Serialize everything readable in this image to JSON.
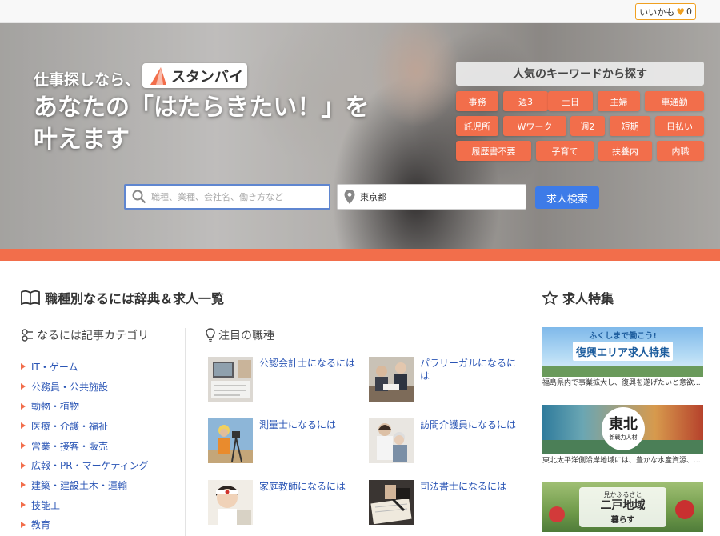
{
  "header": {
    "fav_label": "いいかも",
    "fav_count": "0"
  },
  "hero": {
    "lead": "仕事探しなら、",
    "brand_name": "スタンバイ",
    "headline_line1": "あなたの「はたらきたい！」を",
    "headline_line2": "叶えます"
  },
  "keywords": {
    "title": "人気のキーワードから探す",
    "items": [
      "事務",
      "週3",
      "土日",
      "主婦",
      "車通勤",
      "託児所",
      "Wワーク",
      "週2",
      "短期",
      "日払い",
      "履歴書不要",
      "子育て",
      "扶養内",
      "内職"
    ]
  },
  "search": {
    "keyword_placeholder": "職種、業種、会社名、働き方など",
    "location_value": "東京都",
    "button_label": "求人検索"
  },
  "sections": {
    "dictionary_title": "職種別なるには辞典＆求人一覧",
    "category_title": "なるには記事カテゴリ",
    "featured_jobs_title": "注目の職種",
    "special_title": "求人特集"
  },
  "categories": [
    "IT・ゲーム",
    "公務員・公共施設",
    "動物・植物",
    "医療・介護・福祉",
    "営業・接客・販売",
    "広報・PR・マーケティング",
    "建築・建設土木・運輸",
    "技能工",
    "教育"
  ],
  "jobs": [
    {
      "title": "公認会計士になるには"
    },
    {
      "title": "パラリーガルになるには"
    },
    {
      "title": "測量士になるには"
    },
    {
      "title": "訪問介護員になるには"
    },
    {
      "title": "家庭教師になるには"
    },
    {
      "title": "司法書士になるには"
    }
  ],
  "features": [
    {
      "banner_sub": "ふくしまで働こう!",
      "banner_main": "復興エリア求人特集",
      "caption": "福島県内で事業拡大し、復興を遂げたいと意欲..."
    },
    {
      "banner_main": "東北",
      "banner_sub": "新戦力人材",
      "caption": "東北太平洋側沿岸地域には、豊かな水産資源、..."
    },
    {
      "banner_sub": "見かふるさと",
      "banner_main": "二戸地域",
      "banner_tail": "暮らす"
    }
  ],
  "colors": {
    "accent": "#f26e4b",
    "link": "#2a55b5",
    "search_button": "#3d7be8"
  }
}
